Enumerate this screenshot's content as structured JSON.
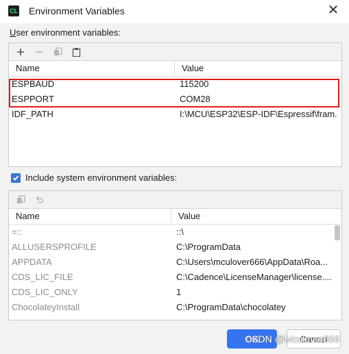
{
  "window": {
    "title": "Environment Variables",
    "close_glyph": "✕"
  },
  "user_section": {
    "label_first": "U",
    "label_rest": "ser environment variables:",
    "toolbar": [
      "plus-icon",
      "minus-icon",
      "copy-icon",
      "paste-icon"
    ],
    "columns": [
      "Name",
      "Value"
    ],
    "rows": [
      {
        "name": "ESPBAUD",
        "value": "115200"
      },
      {
        "name": "ESPPORT",
        "value": "COM28"
      },
      {
        "name": "IDF_PATH",
        "value": "I:\\MCU\\ESP32\\ESP-IDF\\Espressif\\fram..."
      }
    ]
  },
  "system_section": {
    "include_label": "Include system environment variables:",
    "include_checked": true,
    "toolbar": [
      "copy-icon",
      "undo-icon"
    ],
    "columns": [
      "Name",
      "Value"
    ],
    "rows": [
      {
        "name": "=::",
        "value": "::\\"
      },
      {
        "name": "ALLUSERSPROFILE",
        "value": "C:\\ProgramData"
      },
      {
        "name": "APPDATA",
        "value": "C:\\Users\\mculover666\\AppData\\Roa..."
      },
      {
        "name": "CDS_LIC_FILE",
        "value": "C:\\Cadence\\LicenseManager\\license...."
      },
      {
        "name": "CDS_LIC_ONLY",
        "value": "1"
      },
      {
        "name": "ChocolateyInstall",
        "value": "C:\\ProgramData\\chocolatey"
      }
    ]
  },
  "buttons": {
    "ok": "OK",
    "cancel": "Cancel"
  },
  "watermark": "CSDN @Mculover666",
  "colors": {
    "accent": "#3574f0",
    "highlight_box": "#e01b1b"
  }
}
